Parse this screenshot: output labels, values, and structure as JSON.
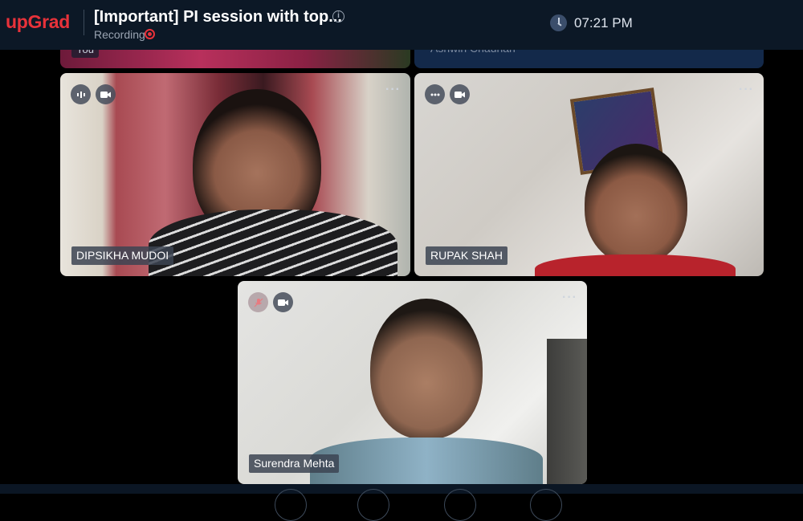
{
  "header": {
    "logo": "upGrad",
    "title": "[Important] PI session with top...",
    "recording_label": "Recording",
    "time": "07:21 PM",
    "brand_color": "#e8323a"
  },
  "participants": {
    "top_left": {
      "label": "You"
    },
    "top_right": {
      "name": "Ashwin Chauhan"
    },
    "dipsikha": {
      "name": "DIPSIKHA MUDOI",
      "mic": "speaking-icon",
      "video": "video-camera-icon"
    },
    "rupak": {
      "name": "RUPAK SHAH",
      "mic": "more-dots-icon",
      "video": "video-camera-icon"
    },
    "surendra": {
      "name": "Surendra Mehta",
      "mic": "mic-muted-icon",
      "video": "video-camera-icon"
    }
  },
  "icons": {
    "more": "···"
  }
}
